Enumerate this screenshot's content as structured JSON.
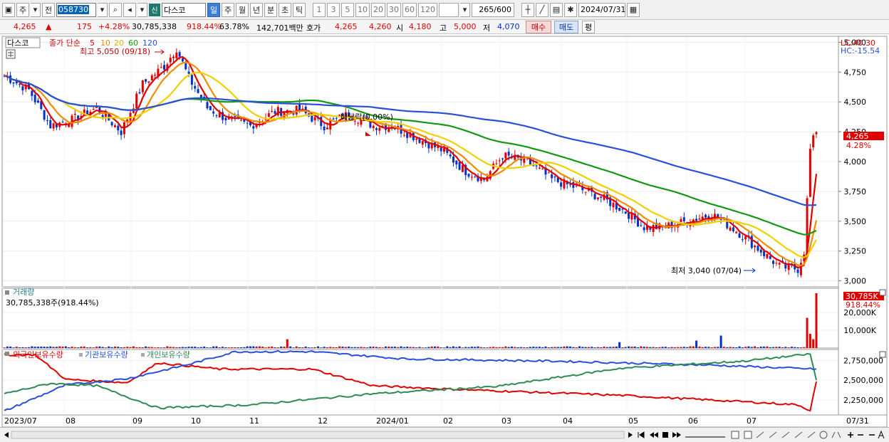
{
  "toolbar": {
    "market": "주",
    "range_toggle": "전",
    "stock_code": "058730",
    "badge": "신",
    "stock_name": "다스코",
    "periods": [
      "일",
      "주",
      "월",
      "년",
      "분",
      "초",
      "틱"
    ],
    "active_period": "일",
    "intervals": [
      "1",
      "3",
      "5",
      "10",
      "20",
      "30",
      "60",
      "120"
    ],
    "count": "265",
    "count_total": "/600",
    "date": "2024/07/31"
  },
  "quote": {
    "price": "4,265",
    "arrow": "▲",
    "change": "175",
    "change_pct": "+4.28%",
    "volume": "30,785,338",
    "volume_ratio": "918.44%",
    "turnover_pct": "63.78%",
    "amount": "142,701백만",
    "hoga_label": "호가",
    "ask": "4,265",
    "bid": "4,260",
    "open_label": "시",
    "open": "4,180",
    "high_label": "고",
    "high": "5,000",
    "low_label": "저",
    "low": "4,070",
    "buy_button": "매수",
    "sell_button": "매도",
    "avg_button": "평"
  },
  "price_panel": {
    "name_tag": "다스코",
    "ma_label": "종가 단순",
    "ma_periods": [
      "5",
      "10",
      "20",
      "60",
      "120"
    ],
    "ma_colors": [
      "#e00000",
      "#f08c00",
      "#f0d000",
      "#119911",
      "#2a4fd8"
    ],
    "high_note": "최고 5,050 (09/18)",
    "low_note": "최저 3,040 (07/04)",
    "dividend_note": "배당락(0.00%)",
    "lc_label": "LC:40.30",
    "hc_label": "HC:-15.54",
    "current_price_tag": "4,265",
    "current_pct_tag": "4.28%",
    "y_ticks": [
      "5,000",
      "4,750",
      "4,500",
      "4,250",
      "4,000",
      "3,750",
      "3,500",
      "3,250",
      "3,000"
    ]
  },
  "volume_panel": {
    "title": "거래량",
    "value_text": "30,785,338주(918.44%)",
    "current_tag": "30,785K",
    "pct_tag": "918.44%",
    "y_ticks": [
      "20,000K",
      "10,000K"
    ]
  },
  "holdings_panel": {
    "legend": [
      "외국인보유수량",
      "기관보유수량",
      "개인보유수량"
    ],
    "colors": [
      "#e00000",
      "#2a4fd8",
      "#2e8b57"
    ],
    "y_ticks": [
      "2,750,000",
      "2,500,000",
      "2,250,000"
    ]
  },
  "x_axis": {
    "labels": [
      "2023/07",
      "08",
      "09",
      "10",
      "11",
      "12",
      "2024/01",
      "02",
      "03",
      "04",
      "05",
      "06",
      "07",
      "07/31"
    ]
  },
  "chart_data": {
    "type": "line",
    "title": "",
    "series": [
      {
        "name": "종가",
        "x": [
          "2023/07",
          "2023/08",
          "2023/09",
          "2023/10",
          "2023/11",
          "2023/12",
          "2024/01",
          "2024/02",
          "2024/03",
          "2024/04",
          "2024/05",
          "2024/06",
          "2024/07",
          "2024/07/31"
        ],
        "values": [
          4700,
          4350,
          4850,
          4350,
          4450,
          4300,
          4250,
          4100,
          3800,
          3450,
          3550,
          3150,
          3100,
          4265
        ]
      },
      {
        "name": "120",
        "x": [
          "2023/07",
          "2023/08",
          "2023/09",
          "2023/10",
          "2023/11",
          "2023/12",
          "2024/01",
          "2024/02",
          "2024/03",
          "2024/04",
          "2024/05",
          "2024/06",
          "2024/07",
          "2024/07/31"
        ],
        "values": [
          4670,
          4630,
          4600,
          4560,
          4550,
          4500,
          4380,
          4250,
          4090,
          3900,
          3800,
          3680,
          3550,
          3540
        ]
      }
    ],
    "ylim": [
      2950,
      5050
    ]
  }
}
